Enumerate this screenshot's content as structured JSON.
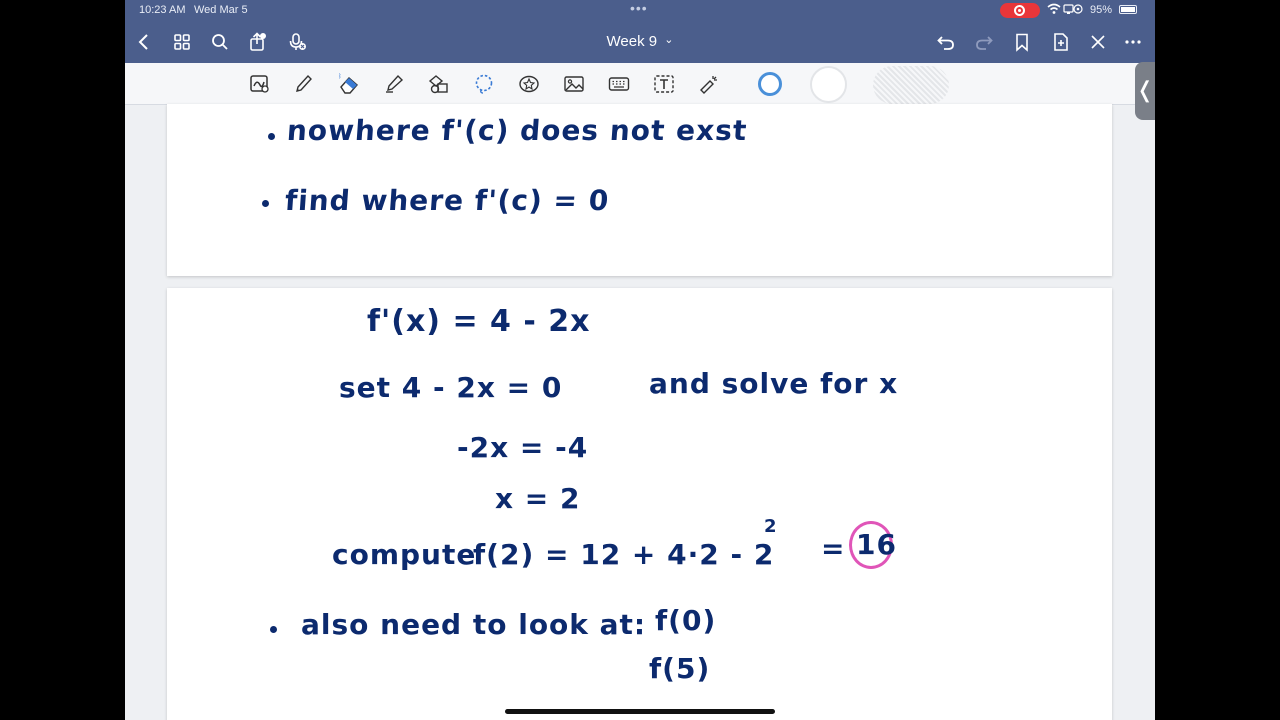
{
  "status_bar": {
    "time": "10:23 AM",
    "date": "Wed Mar 5",
    "battery": "95%",
    "icons": "wifi • screen",
    "dots": "•••"
  },
  "nav": {
    "title": "Week 9",
    "title_chevron": "⌄"
  },
  "toolbar": {
    "colors": [
      "#4a90d9",
      "#ffffff",
      "#e6e6e6"
    ]
  },
  "page1": {
    "lines": [
      {
        "bullet": true,
        "text": "nowhere   f'(c)   does not exst"
      },
      {
        "bullet": true,
        "text": "find  where  f'(c) = 0"
      }
    ]
  },
  "page2": {
    "derivative": "f'(x) = 4 - 2x",
    "set_line": "set   4 - 2x  = 0",
    "solve_text": "and  solve  for  x",
    "step1": "-2x  =  -4",
    "step2": "x  =  2",
    "compute_label": "compute",
    "compute_expr": "f(2) = 12 + 4·2 - 2",
    "exponent": "2",
    "equals": "=",
    "result": "16",
    "also_text": "also  need  to  look  at:",
    "f0": "f(0)",
    "f5": "f(5)"
  },
  "colors": {
    "ink": "#0c2a6e",
    "highlight_circle": "#e055b8",
    "bar": "#4b5e8c"
  }
}
